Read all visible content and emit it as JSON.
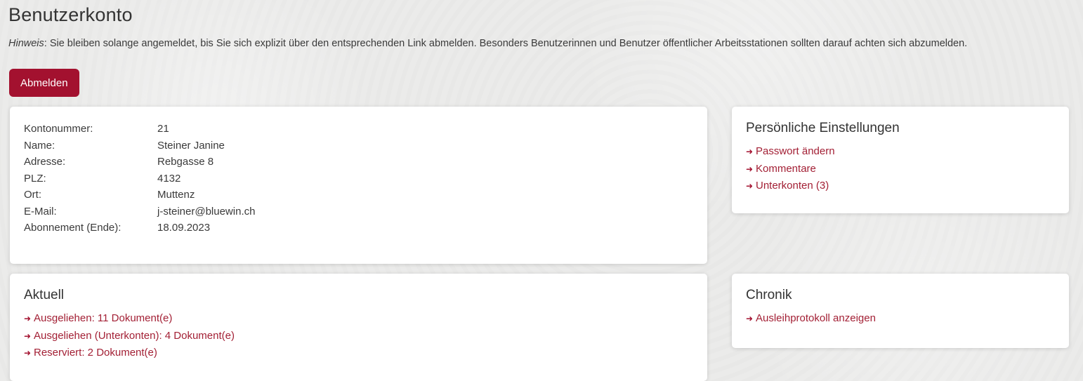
{
  "page": {
    "title": "Benutzerkonto",
    "hint_label": "Hinweis",
    "hint_text": ": Sie bleiben solange angemeldet, bis Sie sich explizit über den entsprechenden Link abmelden. Besonders Benutzerinnen und Benutzer öffentlicher Arbeitsstationen sollten darauf achten sich abzumelden.",
    "logout_label": "Abmelden"
  },
  "account": {
    "rows": [
      {
        "label": "Kontonummer:",
        "value": "21"
      },
      {
        "label": "Name:",
        "value": "Steiner Janine"
      },
      {
        "label": "Adresse:",
        "value": "Rebgasse 8"
      },
      {
        "label": "PLZ:",
        "value": "4132"
      },
      {
        "label": "Ort:",
        "value": "Muttenz"
      },
      {
        "label": "E-Mail:",
        "value": "j-steiner@bluewin.ch"
      },
      {
        "label": "Abonnement (Ende):",
        "value": "18.09.2023"
      }
    ]
  },
  "settings": {
    "title": "Persönliche Einstellungen",
    "links": [
      "Passwort ändern",
      "Kommentare",
      "Unterkonten (3)"
    ]
  },
  "current": {
    "title": "Aktuell",
    "links": [
      "Ausgeliehen: 11 Dokument(e)",
      "Ausgeliehen (Unterkonten): 4 Dokument(e)",
      "Reserviert: 2 Dokument(e)"
    ]
  },
  "chronik": {
    "title": "Chronik",
    "links": [
      "Ausleihprotokoll anzeigen"
    ]
  },
  "icons": {
    "link_arrow": "arrow-right-icon"
  },
  "colors": {
    "accent": "#a3112f",
    "link": "#a32035",
    "text": "#333333"
  }
}
